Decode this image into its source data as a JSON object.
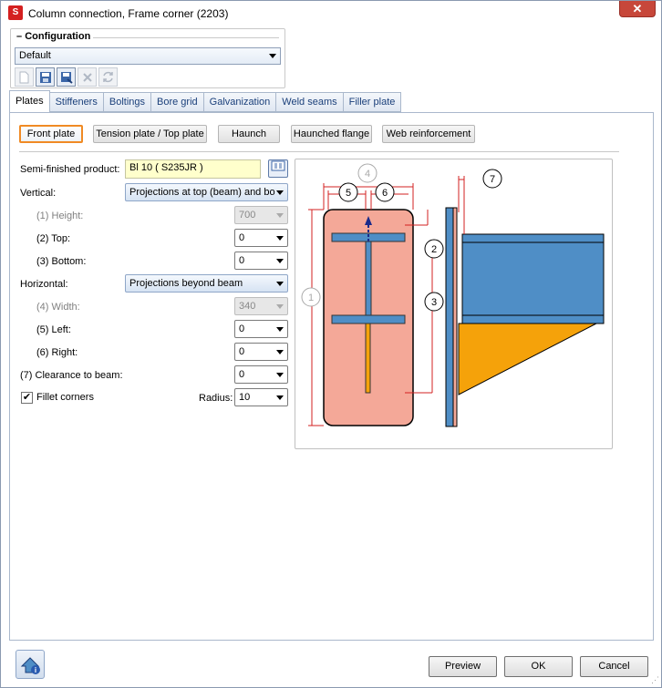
{
  "window": {
    "title": "Column connection, Frame corner (2203)",
    "close_glyph": "✕"
  },
  "configuration": {
    "title": "Configuration",
    "selected": "Default",
    "toolbar": [
      "new-icon",
      "save-icon",
      "save-as-icon",
      "delete-icon",
      "refresh-icon"
    ]
  },
  "tabs": [
    "Plates",
    "Stiffeners",
    "Boltings",
    "Bore grid",
    "Galvanization",
    "Weld seams",
    "Filler plate"
  ],
  "subtabs": [
    "Front plate",
    "Tension plate / Top plate",
    "Haunch",
    "Haunched flange",
    "Web reinforcement"
  ],
  "form": {
    "semi_finished_label": "Semi-finished product:",
    "semi_finished_value": "Bl 10  ( S235JR )",
    "vertical_label": "Vertical:",
    "vertical_value": "Projections at top (beam) and bo",
    "height_label": "(1) Height:",
    "height_value": "700",
    "top_label": "(2) Top:",
    "top_value": "0",
    "bottom_label": "(3) Bottom:",
    "bottom_value": "0",
    "horizontal_label": "Horizontal:",
    "horizontal_value": "Projections beyond beam",
    "width_label": "(4) Width:",
    "width_value": "340",
    "left_label": "(5) Left:",
    "left_value": "0",
    "right_label": "(6) Right:",
    "right_value": "0",
    "clearance_label": "(7) Clearance to beam:",
    "clearance_value": "0",
    "fillet_label": "Fillet corners",
    "fillet_checked": true,
    "radius_label": "Radius:",
    "radius_value": "10"
  },
  "diagram": {
    "markers": [
      "1",
      "2",
      "3",
      "4",
      "5",
      "6",
      "7"
    ],
    "colors": {
      "plate": "#f4a898",
      "steel": "#4f8ec6",
      "haunch": "#f5a20a",
      "dimension": "#d32020"
    }
  },
  "footer": {
    "preview": "Preview",
    "ok": "OK",
    "cancel": "Cancel"
  }
}
